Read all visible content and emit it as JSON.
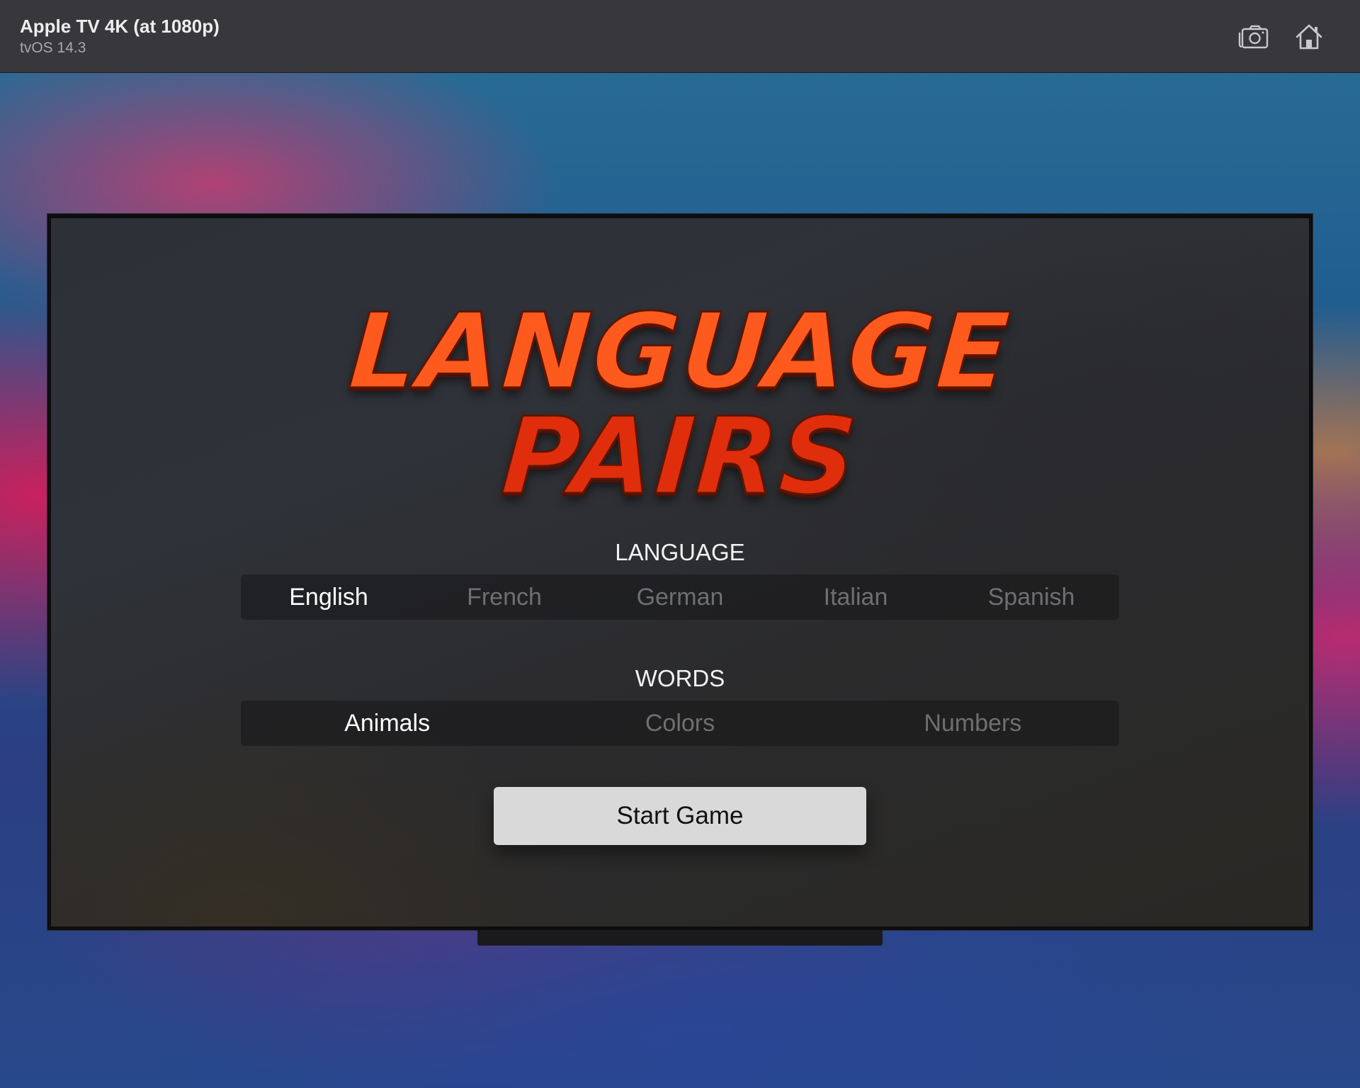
{
  "window": {
    "title": "Apple TV 4K (at 1080p)",
    "subtitle": "tvOS 14.3",
    "icons": {
      "screenshot": "camera-icon",
      "home": "home-icon"
    }
  },
  "app": {
    "logo_line1": "LANGUAGE",
    "logo_line2": "PAIRS",
    "language": {
      "label": "LANGUAGE",
      "options": [
        "English",
        "French",
        "German",
        "Italian",
        "Spanish"
      ],
      "selected": "English"
    },
    "words": {
      "label": "WORDS",
      "options": [
        "Animals",
        "Colors",
        "Numbers"
      ],
      "selected": "Animals"
    },
    "start_button": "Start Game"
  },
  "colors": {
    "logo_orange": "#ff5a1e",
    "logo_red": "#e02e0c",
    "selected_text": "#ffffff",
    "unselected_text": "#6f6f73"
  }
}
